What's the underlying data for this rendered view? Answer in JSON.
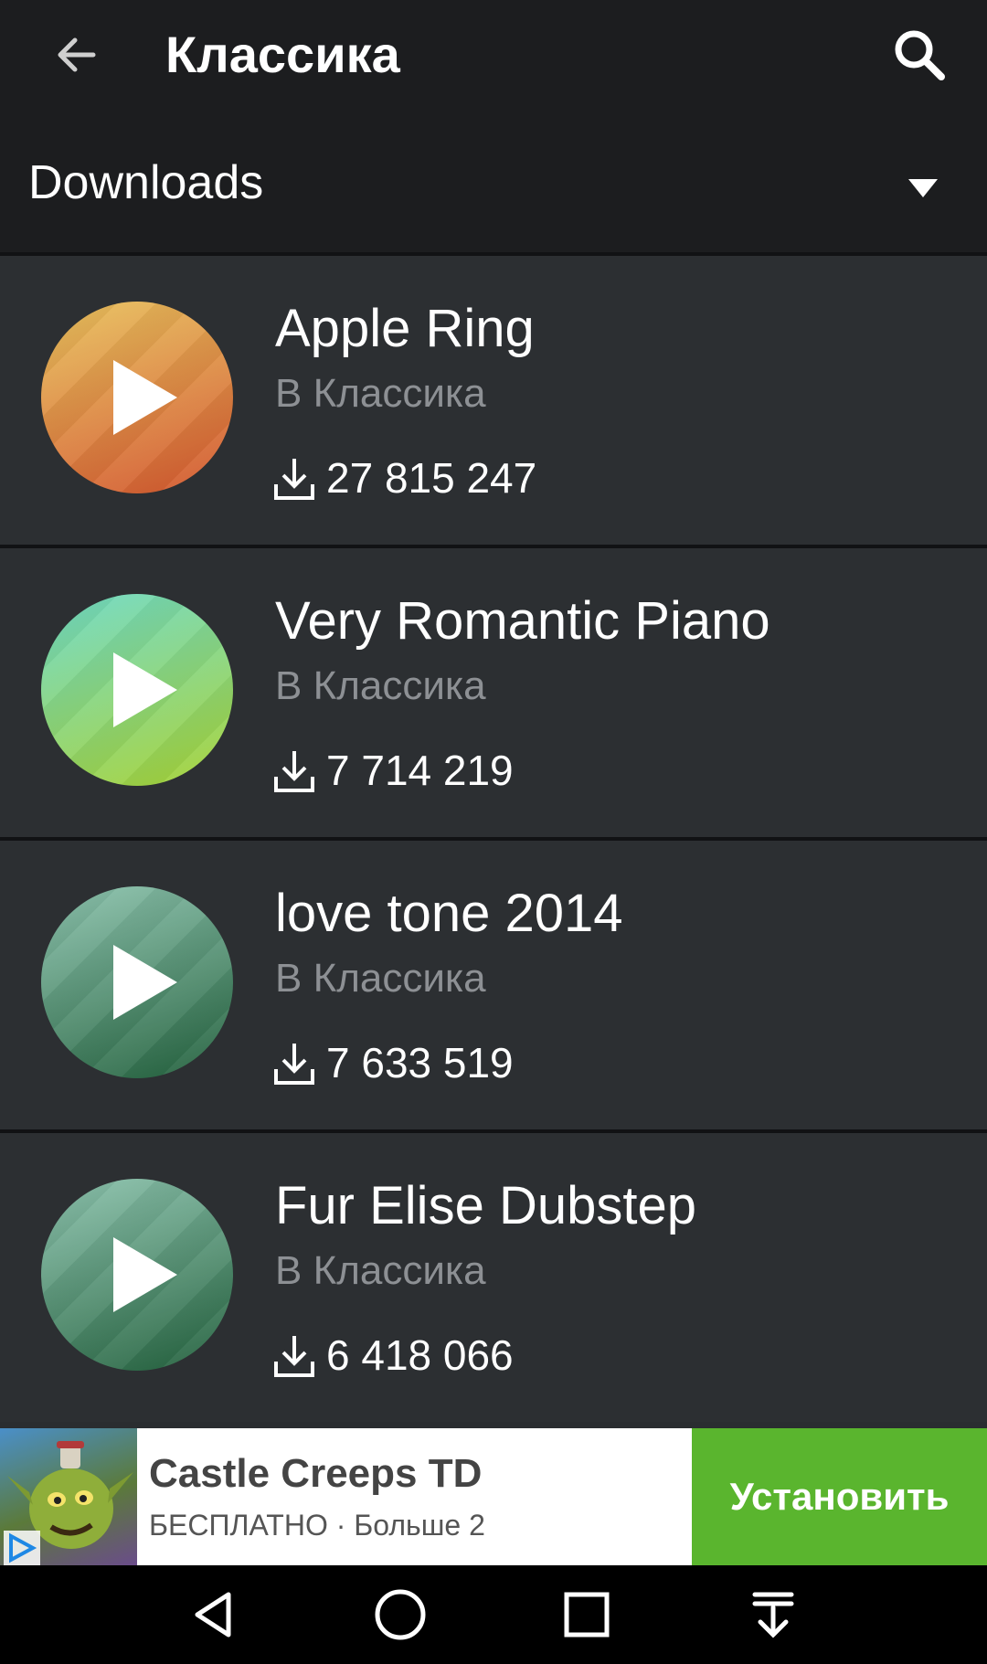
{
  "header": {
    "title": "Классика",
    "back_icon": "arrow-left-icon",
    "search_icon": "search-icon"
  },
  "filter": {
    "label": "Downloads",
    "caret_icon": "dropdown-caret-icon"
  },
  "ringtones": [
    {
      "name": "Apple Ring",
      "category": "В Классика",
      "downloads": "27 815 247",
      "colors": [
        "#e9c35e",
        "#d2552e"
      ]
    },
    {
      "name": "Very Romantic Piano",
      "category": "В Классика",
      "downloads": "7 714 219",
      "colors": [
        "#6fd9c6",
        "#a6d233"
      ]
    },
    {
      "name": "love tone 2014",
      "category": "В Классика",
      "downloads": "7 633 519",
      "colors": [
        "#8fc5b0",
        "#22603c"
      ]
    },
    {
      "name": "Fur Elise Dubstep",
      "category": "В Классика",
      "downloads": "6 418 066",
      "colors": [
        "#8fc5b0",
        "#22603c"
      ]
    }
  ],
  "ad": {
    "title": "Castle Creeps TD",
    "subtitle": "БЕСПЛАТНО · Больше 2",
    "button_label": "Установить"
  },
  "navbar": {
    "back_icon": "nav-back-icon",
    "home_icon": "nav-home-icon",
    "recents_icon": "nav-recents-icon",
    "notifications_icon": "nav-pull-down-icon"
  }
}
